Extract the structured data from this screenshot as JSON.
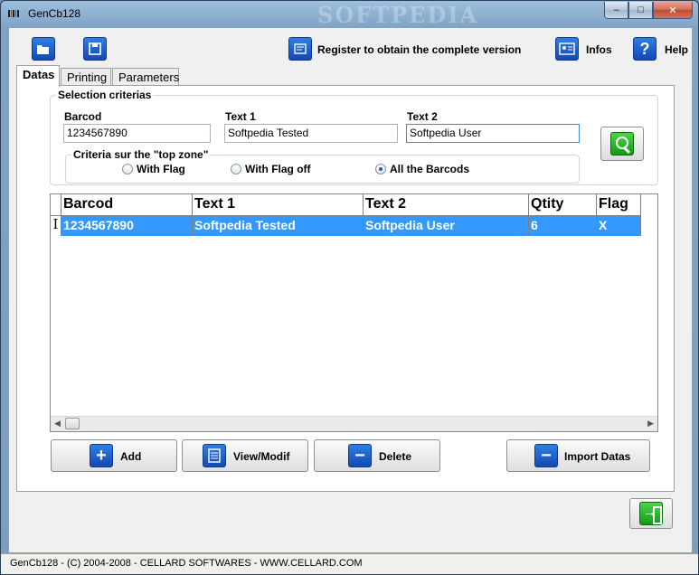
{
  "window": {
    "title": "GenCb128",
    "watermark": "SOFTPEDIA"
  },
  "caption": {
    "minimize": "–",
    "maximize": "□",
    "close": "✕"
  },
  "toolbar": {
    "register_label": "Register to obtain the complete version",
    "infos_label": "Infos",
    "help_label": "Help"
  },
  "tabs": [
    {
      "label": "Datas",
      "active": true
    },
    {
      "label": "Printing",
      "active": false
    },
    {
      "label": "Parameters",
      "active": false
    }
  ],
  "criteria": {
    "title": "Selection criterias",
    "barcod_label": "Barcod",
    "barcod_value": "1234567890",
    "text1_label": "Text 1",
    "text1_value": "Softpedia Tested",
    "text2_label": "Text 2",
    "text2_value": "Softpedia User",
    "topzone_title": "Criteria sur the \"top zone\"",
    "options": [
      "With Flag",
      "With Flag off",
      "All the Barcods"
    ],
    "selected": "All the Barcods"
  },
  "grid": {
    "columns": [
      "Barcod",
      "Text 1",
      "Text 2",
      "Qtity",
      "Flag"
    ],
    "row_indicator": "I",
    "rows": [
      [
        "1234567890",
        "Softpedia Tested",
        "Softpedia User",
        "6",
        "X"
      ]
    ]
  },
  "actions": {
    "add_label": "Add",
    "view_label": "View/Modif",
    "delete_label": "Delete",
    "import_label": "Import Datas"
  },
  "status": {
    "text": "GenCb128 - (C) 2004-2008 - CELLARD SOFTWARES - WWW.CELLARD.COM"
  },
  "colors": {
    "selection": "#3399ff",
    "icon_blue": "#1a5fd0",
    "icon_green": "#1fb51f"
  }
}
